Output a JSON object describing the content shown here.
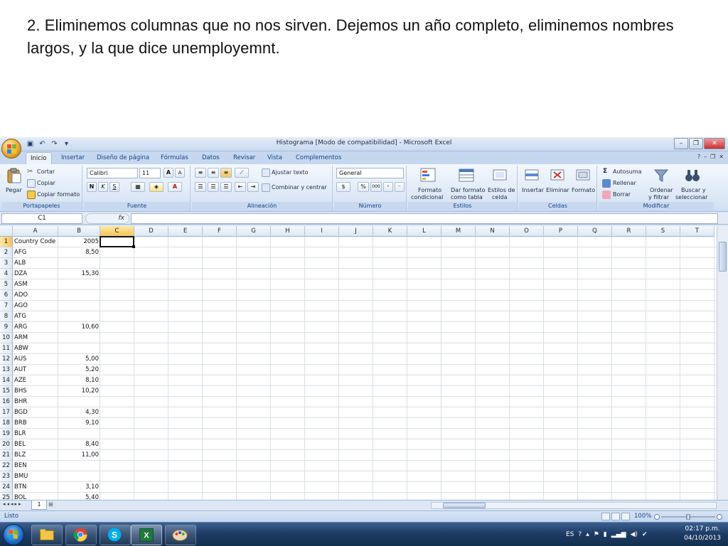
{
  "slide": {
    "caption": "2. Eliminemos columnas que no nos sirven. Dejemos un año completo, eliminemos nombres largos, y la que dice unemployemnt."
  },
  "window": {
    "title": "Histograma  [Modo de compatibilidad] - Microsoft Excel"
  },
  "ribbon_tabs": [
    {
      "label": "Inicio",
      "active": true
    },
    {
      "label": "Insertar"
    },
    {
      "label": "Diseño de página"
    },
    {
      "label": "Fórmulas"
    },
    {
      "label": "Datos"
    },
    {
      "label": "Revisar"
    },
    {
      "label": "Vista"
    },
    {
      "label": "Complementos"
    }
  ],
  "ribbon": {
    "clipboard": {
      "paste": "Pegar",
      "cut": "Cortar",
      "copy": "Copiar",
      "format_painter": "Copiar formato",
      "group": "Portapapeles"
    },
    "font": {
      "name": "Calibri",
      "size": "11",
      "bold": "N",
      "italic": "K",
      "underline": "S",
      "grow": "A",
      "shrink": "A",
      "color_letter": "A",
      "group": "Fuente"
    },
    "alignment": {
      "wrap": "Ajustar texto",
      "merge": "Combinar y centrar",
      "group": "Alineación"
    },
    "number": {
      "format": "General",
      "currency": "$",
      "percent": "%",
      "thousands": "000",
      "group": "Número"
    },
    "styles": {
      "conditional_1": "Formato",
      "conditional_2": "condicional",
      "table_1": "Dar formato",
      "table_2": "como tabla",
      "cell_1": "Estilos de",
      "cell_2": "celda",
      "group": "Estilos"
    },
    "cells": {
      "insert": "Insertar",
      "delete": "Eliminar",
      "format": "Formato",
      "group": "Celdas"
    },
    "editing": {
      "autosum": "Autosuma",
      "fill": "Rellenar",
      "clear": "Borrar",
      "sort_1": "Ordenar",
      "sort_2": "y filtrar",
      "find_1": "Buscar y",
      "find_2": "seleccionar",
      "group": "Modificar"
    }
  },
  "formula_bar": {
    "name_box": "C1",
    "fx": "fx",
    "value": ""
  },
  "columns": [
    "A",
    "B",
    "C",
    "D",
    "E",
    "F",
    "G",
    "H",
    "I",
    "J",
    "K",
    "L",
    "M",
    "N",
    "O",
    "P",
    "Q",
    "R",
    "S",
    "T"
  ],
  "selected_column": "C",
  "rows": [
    {
      "n": "1",
      "a": "Country Code",
      "b": "2005"
    },
    {
      "n": "2",
      "a": "AFG",
      "b": "8,50"
    },
    {
      "n": "3",
      "a": "ALB",
      "b": ""
    },
    {
      "n": "4",
      "a": "DZA",
      "b": "15,30"
    },
    {
      "n": "5",
      "a": "ASM",
      "b": ""
    },
    {
      "n": "6",
      "a": "ADO",
      "b": ""
    },
    {
      "n": "7",
      "a": "AGO",
      "b": ""
    },
    {
      "n": "8",
      "a": "ATG",
      "b": ""
    },
    {
      "n": "9",
      "a": "ARG",
      "b": "10,60"
    },
    {
      "n": "10",
      "a": "ARM",
      "b": ""
    },
    {
      "n": "11",
      "a": "ABW",
      "b": ""
    },
    {
      "n": "12",
      "a": "AUS",
      "b": "5,00"
    },
    {
      "n": "13",
      "a": "AUT",
      "b": "5,20"
    },
    {
      "n": "14",
      "a": "AZE",
      "b": "8,10"
    },
    {
      "n": "15",
      "a": "BHS",
      "b": "10,20"
    },
    {
      "n": "16",
      "a": "BHR",
      "b": ""
    },
    {
      "n": "17",
      "a": "BGD",
      "b": "4,30"
    },
    {
      "n": "18",
      "a": "BRB",
      "b": "9,10"
    },
    {
      "n": "19",
      "a": "BLR",
      "b": ""
    },
    {
      "n": "20",
      "a": "BEL",
      "b": "8,40"
    },
    {
      "n": "21",
      "a": "BLZ",
      "b": "11,00"
    },
    {
      "n": "22",
      "a": "BEN",
      "b": ""
    },
    {
      "n": "23",
      "a": "BMU",
      "b": ""
    },
    {
      "n": "24",
      "a": "BTN",
      "b": "3,10"
    },
    {
      "n": "25",
      "a": "BOL",
      "b": "5,40"
    }
  ],
  "sheet": {
    "tab": "1"
  },
  "status": {
    "ready": "Listo",
    "zoom": "100%"
  },
  "tray": {
    "lang": "ES",
    "time": "02:17 p.m.",
    "date": "04/10/2013"
  },
  "colors": {
    "accent": "#15428b",
    "selected_header": "#f6c35b",
    "taskbar": "#1c3a63"
  }
}
